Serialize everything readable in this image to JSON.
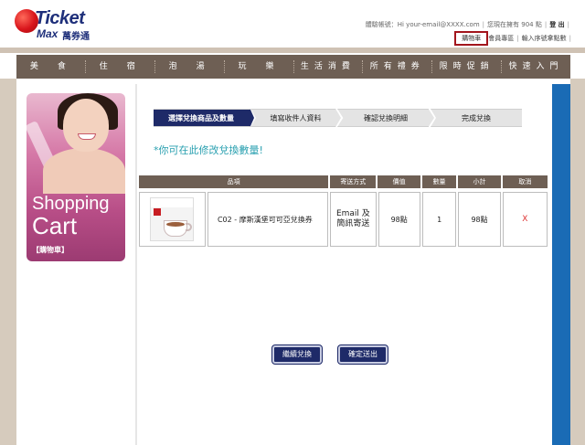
{
  "brand": {
    "name_en": "Ticket",
    "name_en2": "Max",
    "name_cn": "萬券通"
  },
  "header": {
    "greeting": "體驗帳號：Hi your-email@XXXX.com",
    "points": "您現在擁有 904 點",
    "logout": "登 出",
    "links": [
      "購物車",
      "會員專區",
      "輸入序號拿點數"
    ]
  },
  "nav": {
    "items": [
      "美　食",
      "住　宿",
      "泡　湯",
      "玩　樂",
      "生活消費",
      "所有禮券",
      "限時促銷",
      "快速入門"
    ]
  },
  "sidebar": {
    "banner_title1": "Shopping",
    "banner_title2": "Cart",
    "banner_sub": "【購物車】"
  },
  "steps": [
    "選擇兌換商品及數量",
    "填寫收件人資料",
    "確認兌換明細",
    "完成兌換"
  ],
  "notice": "*你可在此修改兌換數量!",
  "table": {
    "headers": [
      "品項",
      "寄送方式",
      "價值",
      "數量",
      "小計",
      "取消"
    ],
    "rows": [
      {
        "item": "C02 - 摩斯漢堡可可亞兌換券",
        "delivery_line1": "Email 及",
        "delivery_line2": "簡訊寄送",
        "value": "98點",
        "qty": "1",
        "subtotal": "98點",
        "cancel": "X"
      }
    ]
  },
  "buttons": {
    "continue": "繼續兌換",
    "confirm": "確定送出"
  },
  "colors": {
    "nav_bg": "#6e5f54",
    "primary": "#1e2a68",
    "accent_blue": "#1a6bb5",
    "notice": "#2aa0b0",
    "cancel_x": "#dd3333"
  }
}
